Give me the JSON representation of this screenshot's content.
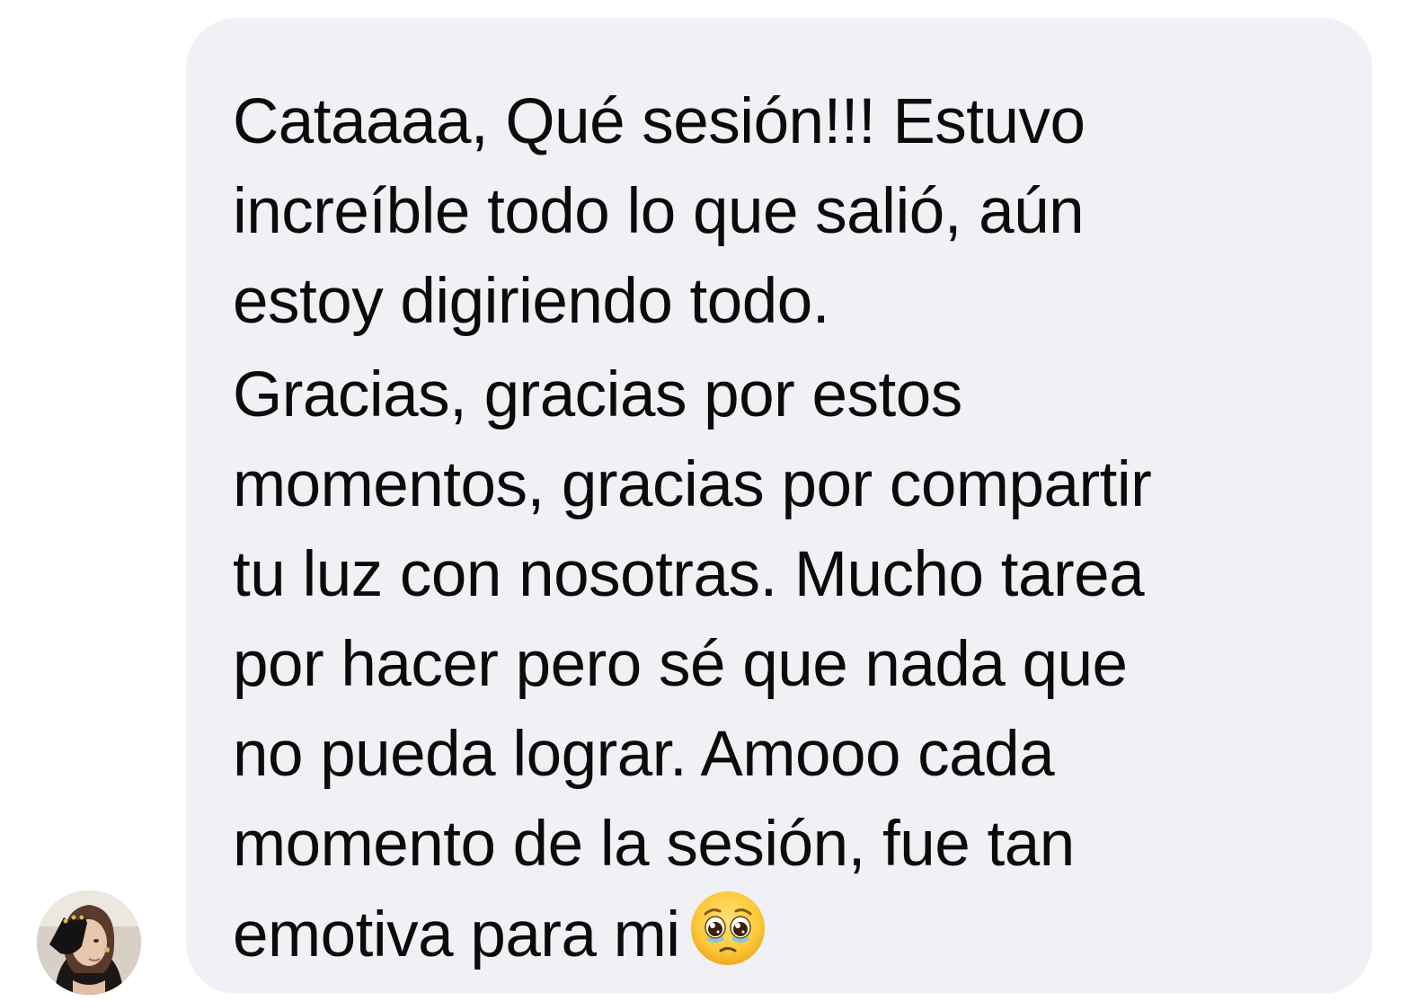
{
  "sender": {
    "avatar_icon": "profile-photo-woman-hand-over-face"
  },
  "message": {
    "paragraphs": [
      {
        "lines": [
          "Cataaaa, Qué sesión!!! Estuvo",
          "increíble todo lo que salió, aún",
          "estoy digiriendo todo."
        ]
      },
      {
        "lines": [
          "Gracias, gracias por estos",
          "momentos, gracias por compartir",
          "tu luz con nosotras. Mucho tarea",
          "por hacer pero sé que nada que",
          "no pueda lograr. Amooo cada",
          "momento de la sesión, fue tan",
          "emotiva para mi"
        ]
      }
    ],
    "trailing_emoji": "pleading-face-emoji",
    "bubble_color": "#f0f1f4",
    "text_color": "#0b0b0b"
  }
}
